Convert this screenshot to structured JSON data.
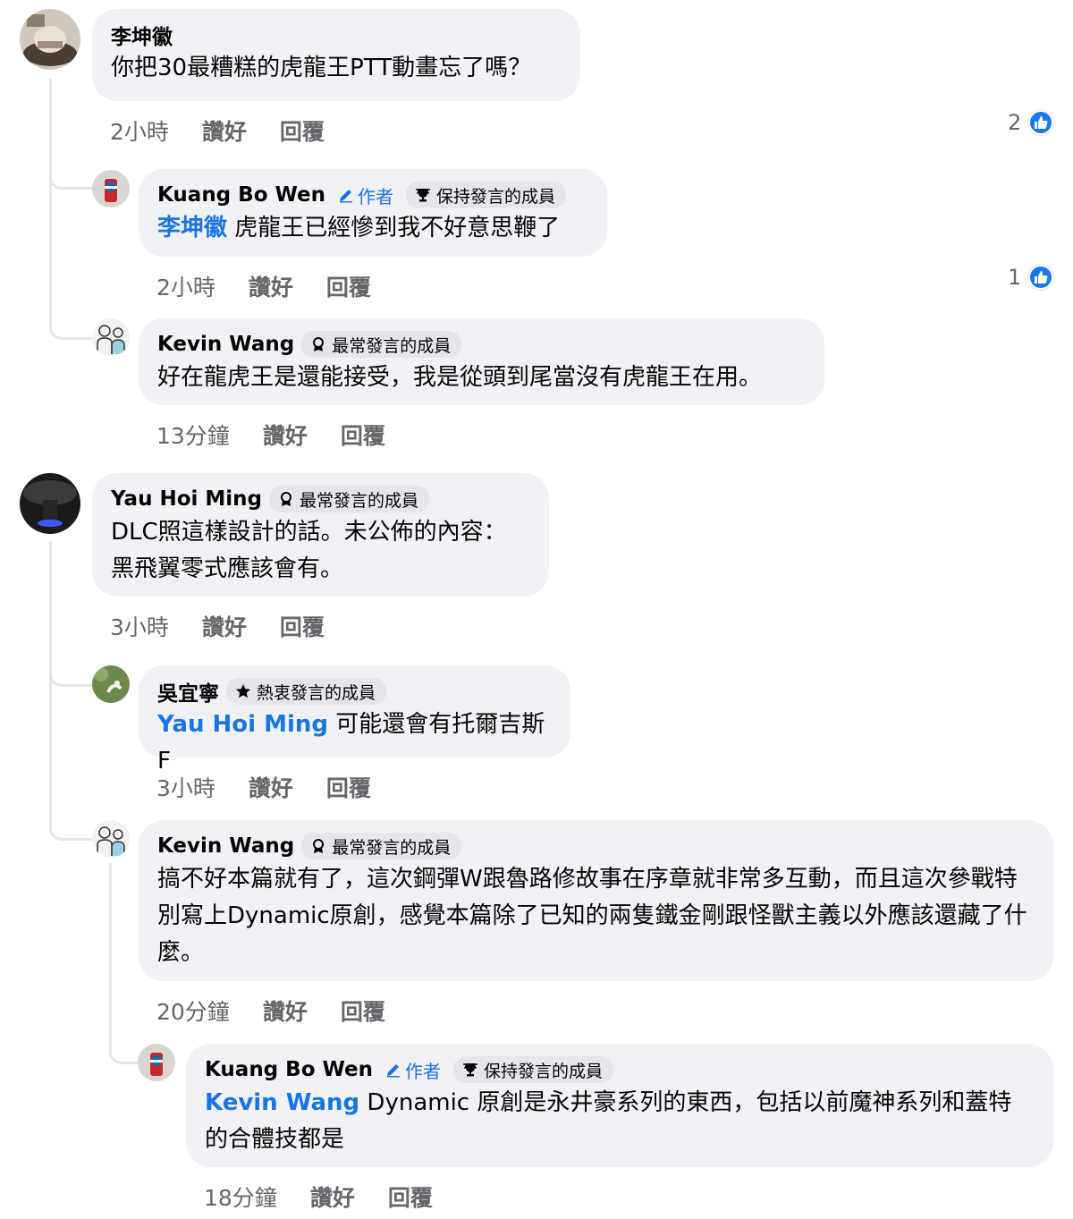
{
  "author_label": "作者",
  "like_label": "讚好",
  "reply_label": "回覆",
  "colors": {
    "mention": "#1b74e4",
    "bubble": "#f0f2f5",
    "meta": "#65676b",
    "like": "#1877f2"
  },
  "c1": {
    "name": "李坤徽",
    "text": "你把30最糟糕的虎龍王PTT動畫忘了嗎？",
    "time": "2小時",
    "likes": "2"
  },
  "c1r1": {
    "name": "Kuang Bo Wen",
    "badge": "保持發言的成員",
    "badge_icon": "trophy-icon",
    "mention": "李坤徽",
    "text": " 虎龍王已經慘到我不好意思鞭了",
    "time": "2小時",
    "likes": "1"
  },
  "c1r2": {
    "name": "Kevin Wang",
    "badge": "最常發言的成員",
    "badge_icon": "award-ribbon-icon",
    "text": "好在龍虎王是還能接受，我是從頭到尾當沒有虎龍王在用。",
    "time": "13分鐘"
  },
  "c2": {
    "name": "Yau Hoi Ming",
    "badge": "最常發言的成員",
    "badge_icon": "award-ribbon-icon",
    "text": "DLC照這樣設計的話。未公佈的內容：\n黑飛翼零式應該會有。",
    "time": "3小時"
  },
  "c2r1": {
    "name": "吳宜寧",
    "badge": "熱衷發言的成員",
    "badge_icon": "star-icon",
    "mention": "Yau Hoi Ming",
    "text": " 可能還會有托爾吉斯F",
    "time": "3小時"
  },
  "c2r2": {
    "name": "Kevin Wang",
    "badge": "最常發言的成員",
    "badge_icon": "award-ribbon-icon",
    "text": "搞不好本篇就有了，這次鋼彈W跟魯路修故事在序章就非常多互動，而且這次參戰特別寫上Dynamic原創，感覺本篇除了已知的兩隻鐵金剛跟怪獸主義以外應該還藏了什麼。",
    "time": "20分鐘"
  },
  "c2r2r1": {
    "name": "Kuang Bo Wen",
    "badge": "保持發言的成員",
    "badge_icon": "trophy-icon",
    "mention": "Kevin Wang",
    "text": " Dynamic 原創是永井豪系列的東西，包括以前魔神系列和蓋特的合體技都是",
    "time": "18分鐘"
  }
}
